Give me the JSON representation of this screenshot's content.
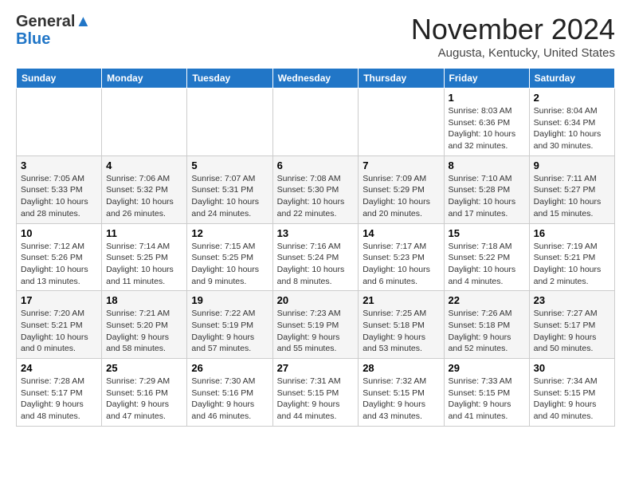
{
  "header": {
    "logo_line1": "General",
    "logo_line2": "Blue",
    "month": "November 2024",
    "location": "Augusta, Kentucky, United States"
  },
  "weekdays": [
    "Sunday",
    "Monday",
    "Tuesday",
    "Wednesday",
    "Thursday",
    "Friday",
    "Saturday"
  ],
  "weeks": [
    [
      {
        "day": "",
        "info": ""
      },
      {
        "day": "",
        "info": ""
      },
      {
        "day": "",
        "info": ""
      },
      {
        "day": "",
        "info": ""
      },
      {
        "day": "",
        "info": ""
      },
      {
        "day": "1",
        "info": "Sunrise: 8:03 AM\nSunset: 6:36 PM\nDaylight: 10 hours\nand 32 minutes."
      },
      {
        "day": "2",
        "info": "Sunrise: 8:04 AM\nSunset: 6:34 PM\nDaylight: 10 hours\nand 30 minutes."
      }
    ],
    [
      {
        "day": "3",
        "info": "Sunrise: 7:05 AM\nSunset: 5:33 PM\nDaylight: 10 hours\nand 28 minutes."
      },
      {
        "day": "4",
        "info": "Sunrise: 7:06 AM\nSunset: 5:32 PM\nDaylight: 10 hours\nand 26 minutes."
      },
      {
        "day": "5",
        "info": "Sunrise: 7:07 AM\nSunset: 5:31 PM\nDaylight: 10 hours\nand 24 minutes."
      },
      {
        "day": "6",
        "info": "Sunrise: 7:08 AM\nSunset: 5:30 PM\nDaylight: 10 hours\nand 22 minutes."
      },
      {
        "day": "7",
        "info": "Sunrise: 7:09 AM\nSunset: 5:29 PM\nDaylight: 10 hours\nand 20 minutes."
      },
      {
        "day": "8",
        "info": "Sunrise: 7:10 AM\nSunset: 5:28 PM\nDaylight: 10 hours\nand 17 minutes."
      },
      {
        "day": "9",
        "info": "Sunrise: 7:11 AM\nSunset: 5:27 PM\nDaylight: 10 hours\nand 15 minutes."
      }
    ],
    [
      {
        "day": "10",
        "info": "Sunrise: 7:12 AM\nSunset: 5:26 PM\nDaylight: 10 hours\nand 13 minutes."
      },
      {
        "day": "11",
        "info": "Sunrise: 7:14 AM\nSunset: 5:25 PM\nDaylight: 10 hours\nand 11 minutes."
      },
      {
        "day": "12",
        "info": "Sunrise: 7:15 AM\nSunset: 5:25 PM\nDaylight: 10 hours\nand 9 minutes."
      },
      {
        "day": "13",
        "info": "Sunrise: 7:16 AM\nSunset: 5:24 PM\nDaylight: 10 hours\nand 8 minutes."
      },
      {
        "day": "14",
        "info": "Sunrise: 7:17 AM\nSunset: 5:23 PM\nDaylight: 10 hours\nand 6 minutes."
      },
      {
        "day": "15",
        "info": "Sunrise: 7:18 AM\nSunset: 5:22 PM\nDaylight: 10 hours\nand 4 minutes."
      },
      {
        "day": "16",
        "info": "Sunrise: 7:19 AM\nSunset: 5:21 PM\nDaylight: 10 hours\nand 2 minutes."
      }
    ],
    [
      {
        "day": "17",
        "info": "Sunrise: 7:20 AM\nSunset: 5:21 PM\nDaylight: 10 hours\nand 0 minutes."
      },
      {
        "day": "18",
        "info": "Sunrise: 7:21 AM\nSunset: 5:20 PM\nDaylight: 9 hours\nand 58 minutes."
      },
      {
        "day": "19",
        "info": "Sunrise: 7:22 AM\nSunset: 5:19 PM\nDaylight: 9 hours\nand 57 minutes."
      },
      {
        "day": "20",
        "info": "Sunrise: 7:23 AM\nSunset: 5:19 PM\nDaylight: 9 hours\nand 55 minutes."
      },
      {
        "day": "21",
        "info": "Sunrise: 7:25 AM\nSunset: 5:18 PM\nDaylight: 9 hours\nand 53 minutes."
      },
      {
        "day": "22",
        "info": "Sunrise: 7:26 AM\nSunset: 5:18 PM\nDaylight: 9 hours\nand 52 minutes."
      },
      {
        "day": "23",
        "info": "Sunrise: 7:27 AM\nSunset: 5:17 PM\nDaylight: 9 hours\nand 50 minutes."
      }
    ],
    [
      {
        "day": "24",
        "info": "Sunrise: 7:28 AM\nSunset: 5:17 PM\nDaylight: 9 hours\nand 48 minutes."
      },
      {
        "day": "25",
        "info": "Sunrise: 7:29 AM\nSunset: 5:16 PM\nDaylight: 9 hours\nand 47 minutes."
      },
      {
        "day": "26",
        "info": "Sunrise: 7:30 AM\nSunset: 5:16 PM\nDaylight: 9 hours\nand 46 minutes."
      },
      {
        "day": "27",
        "info": "Sunrise: 7:31 AM\nSunset: 5:15 PM\nDaylight: 9 hours\nand 44 minutes."
      },
      {
        "day": "28",
        "info": "Sunrise: 7:32 AM\nSunset: 5:15 PM\nDaylight: 9 hours\nand 43 minutes."
      },
      {
        "day": "29",
        "info": "Sunrise: 7:33 AM\nSunset: 5:15 PM\nDaylight: 9 hours\nand 41 minutes."
      },
      {
        "day": "30",
        "info": "Sunrise: 7:34 AM\nSunset: 5:15 PM\nDaylight: 9 hours\nand 40 minutes."
      }
    ]
  ]
}
